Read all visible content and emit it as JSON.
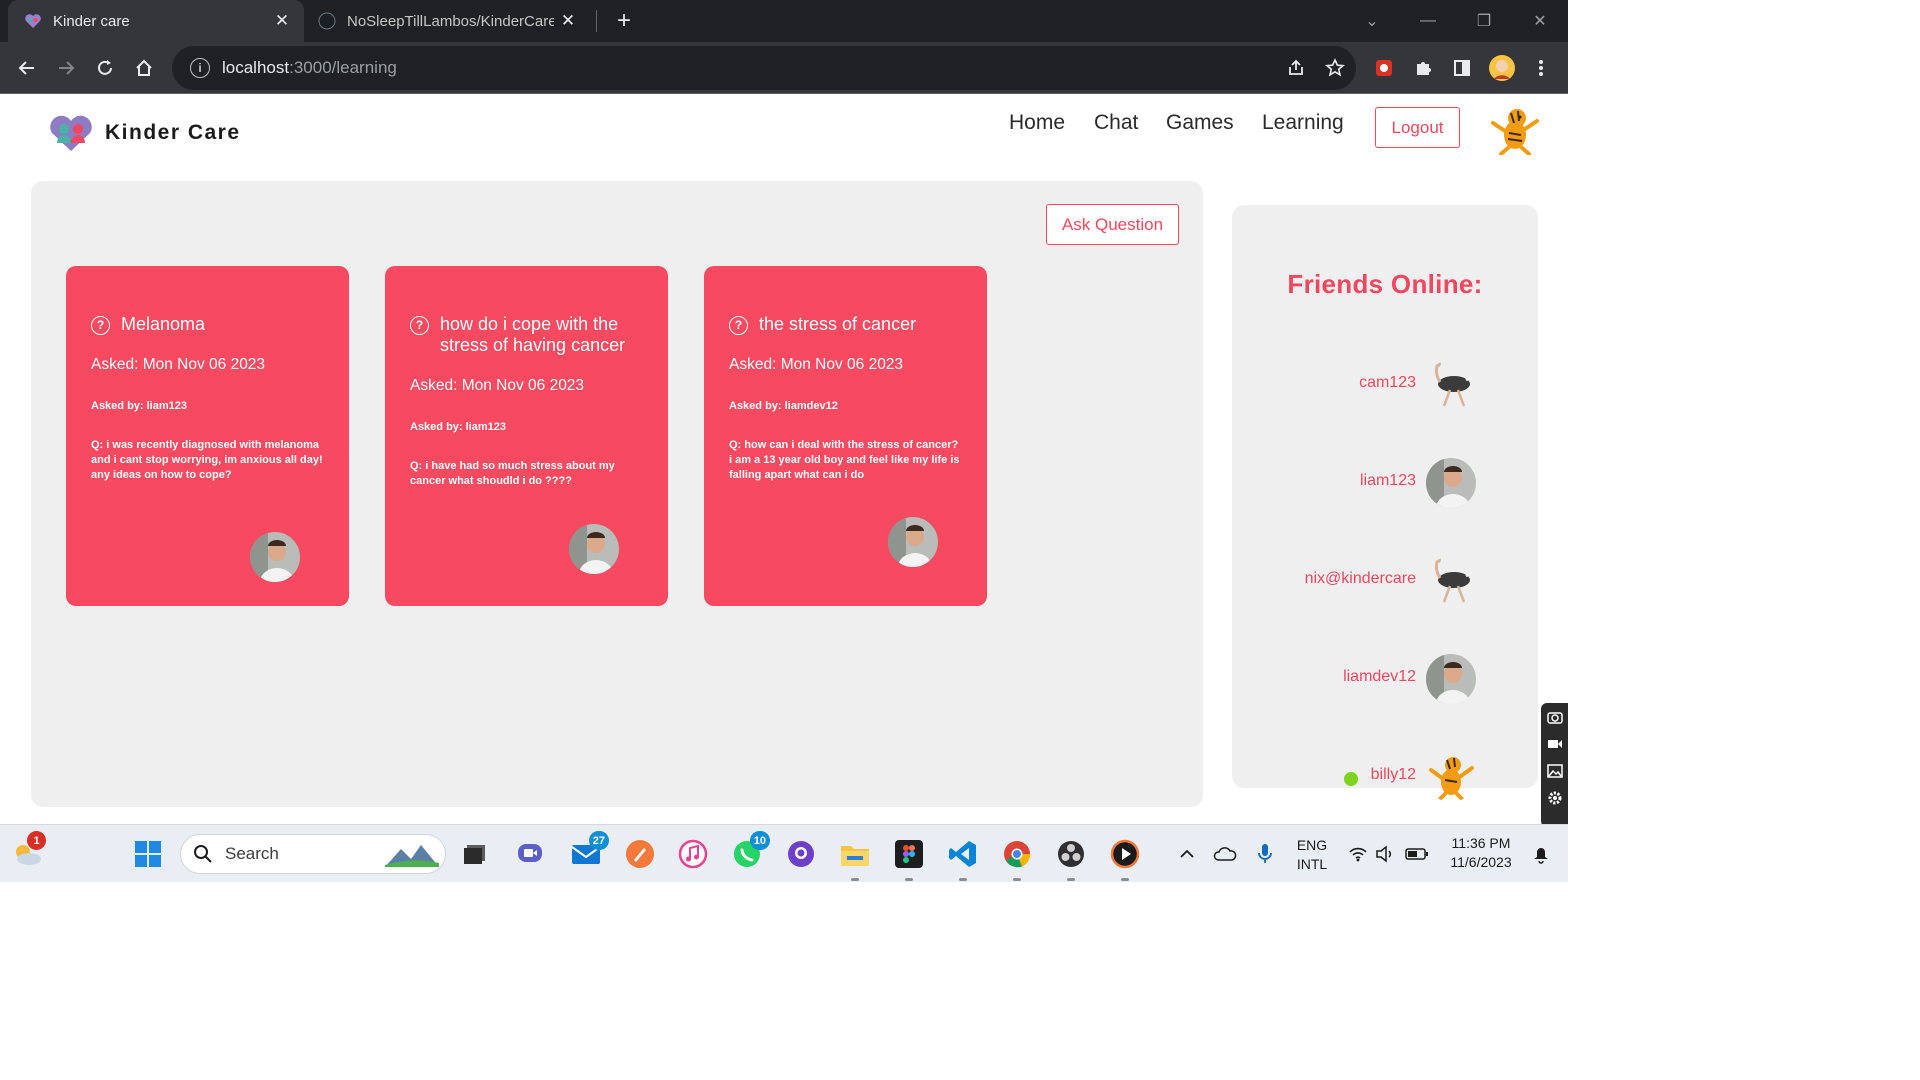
{
  "browser": {
    "tabs": [
      {
        "title": "Kinder care",
        "active": true
      },
      {
        "title": "NoSleepTillLambos/KinderCare:",
        "active": false
      }
    ],
    "url_host": "localhost",
    "url_path": ":3000/learning"
  },
  "site": {
    "brand": "Kinder Care",
    "nav": [
      "Home",
      "Chat",
      "Games",
      "Learning"
    ],
    "logout_label": "Logout",
    "ask_question_label": "Ask Question",
    "accent_color": "#f74a61"
  },
  "questions": [
    {
      "title": "Melanoma",
      "asked": "Asked: Mon Nov 06 2023",
      "asked_by": "Asked by: liam123",
      "question": "Q: i was recently diagnosed with melanoma and i cant stop worrying, im anxious all day! any ideas on how to cope?"
    },
    {
      "title": "how do i cope with the stress of having cancer",
      "asked": "Asked: Mon Nov 06 2023",
      "asked_by": "Asked by: liam123",
      "question": "Q: i have had so much stress about my cancer what shoudld i do ????"
    },
    {
      "title": "the stress of cancer",
      "asked": "Asked: Mon Nov 06 2023",
      "asked_by": "Asked by: liamdev12",
      "question": "Q: how can i deal with the stress of cancer? i am a 13 year old boy and feel like my life is falling apart what can i do"
    }
  ],
  "friends": {
    "title": "Friends Online:",
    "list": [
      {
        "name": "cam123",
        "avatar": "ostrich",
        "online": false
      },
      {
        "name": "liam123",
        "avatar": "person",
        "online": false
      },
      {
        "name": "nix@kindercare",
        "avatar": "ostrich",
        "online": false
      },
      {
        "name": "liamdev12",
        "avatar": "person",
        "online": false
      },
      {
        "name": "billy12",
        "avatar": "tiger",
        "online": true
      }
    ]
  },
  "taskbar": {
    "search_placeholder": "Search",
    "weather_badge": "1",
    "mail_badge": "27",
    "whatsapp_badge": "10",
    "lang_line1": "ENG",
    "lang_line2": "INTL",
    "time": "11:36 PM",
    "date": "11/6/2023"
  }
}
